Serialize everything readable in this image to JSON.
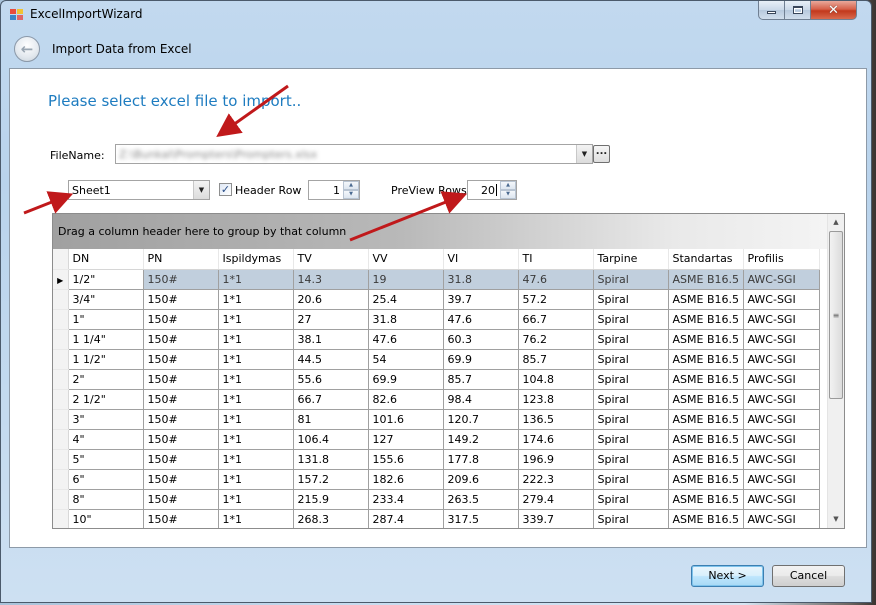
{
  "window": {
    "title": "ExcelImportWizard",
    "caption_buttons": {
      "minimize": "minimize",
      "maximize": "maximize",
      "close": "✕"
    }
  },
  "navbar": {
    "back_icon": "←",
    "title": "Import Data from Excel"
  },
  "form": {
    "heading": "Please select excel file to import..",
    "filename_label": "FileName:",
    "filename_value": "Z:\\Bunkal\\Prompters\\Prompters.xlsx",
    "browse_label": "...",
    "sheet_value": "Sheet1",
    "header_row_label": "Header Row",
    "header_row_checked": true,
    "header_row_value": "1",
    "preview_rows_label": "PreView Rows:",
    "preview_rows_value": "20"
  },
  "grid": {
    "group_panel_text": "Drag a column header here to group by that column",
    "columns": [
      "DN",
      "PN",
      "Ispildymas",
      "TV",
      "VV",
      "VI",
      "TI",
      "Tarpine",
      "Standartas",
      "Profilis"
    ],
    "rows": [
      [
        "1/2\"",
        "150#",
        "1*1",
        "14.3",
        "19",
        "31.8",
        "47.6",
        "Spiral",
        "ASME B16.5",
        "AWC-SGI"
      ],
      [
        "3/4\"",
        "150#",
        "1*1",
        "20.6",
        "25.4",
        "39.7",
        "57.2",
        "Spiral",
        "ASME B16.5",
        "AWC-SGI"
      ],
      [
        "1\"",
        "150#",
        "1*1",
        "27",
        "31.8",
        "47.6",
        "66.7",
        "Spiral",
        "ASME B16.5",
        "AWC-SGI"
      ],
      [
        "1 1/4\"",
        "150#",
        "1*1",
        "38.1",
        "47.6",
        "60.3",
        "76.2",
        "Spiral",
        "ASME B16.5",
        "AWC-SGI"
      ],
      [
        "1 1/2\"",
        "150#",
        "1*1",
        "44.5",
        "54",
        "69.9",
        "85.7",
        "Spiral",
        "ASME B16.5",
        "AWC-SGI"
      ],
      [
        "2\"",
        "150#",
        "1*1",
        "55.6",
        "69.9",
        "85.7",
        "104.8",
        "Spiral",
        "ASME B16.5",
        "AWC-SGI"
      ],
      [
        "2 1/2\"",
        "150#",
        "1*1",
        "66.7",
        "82.6",
        "98.4",
        "123.8",
        "Spiral",
        "ASME B16.5",
        "AWC-SGI"
      ],
      [
        "3\"",
        "150#",
        "1*1",
        "81",
        "101.6",
        "120.7",
        "136.5",
        "Spiral",
        "ASME B16.5",
        "AWC-SGI"
      ],
      [
        "4\"",
        "150#",
        "1*1",
        "106.4",
        "127",
        "149.2",
        "174.6",
        "Spiral",
        "ASME B16.5",
        "AWC-SGI"
      ],
      [
        "5\"",
        "150#",
        "1*1",
        "131.8",
        "155.6",
        "177.8",
        "196.9",
        "Spiral",
        "ASME B16.5",
        "AWC-SGI"
      ],
      [
        "6\"",
        "150#",
        "1*1",
        "157.2",
        "182.6",
        "209.6",
        "222.3",
        "Spiral",
        "ASME B16.5",
        "AWC-SGI"
      ],
      [
        "8\"",
        "150#",
        "1*1",
        "215.9",
        "233.4",
        "263.5",
        "279.4",
        "Spiral",
        "ASME B16.5",
        "AWC-SGI"
      ],
      [
        "10\"",
        "150#",
        "1*1",
        "268.3",
        "287.4",
        "317.5",
        "339.7",
        "Spiral",
        "ASME B16.5",
        "AWC-SGI"
      ]
    ],
    "selected_row": 0,
    "row_indicator": "▶"
  },
  "footer": {
    "next_label": "Next >",
    "cancel_label": "Cancel"
  },
  "colors": {
    "heading": "#1e7cc0",
    "selection": "#c1cfdd",
    "annotation_arrow": "#c0191b"
  }
}
